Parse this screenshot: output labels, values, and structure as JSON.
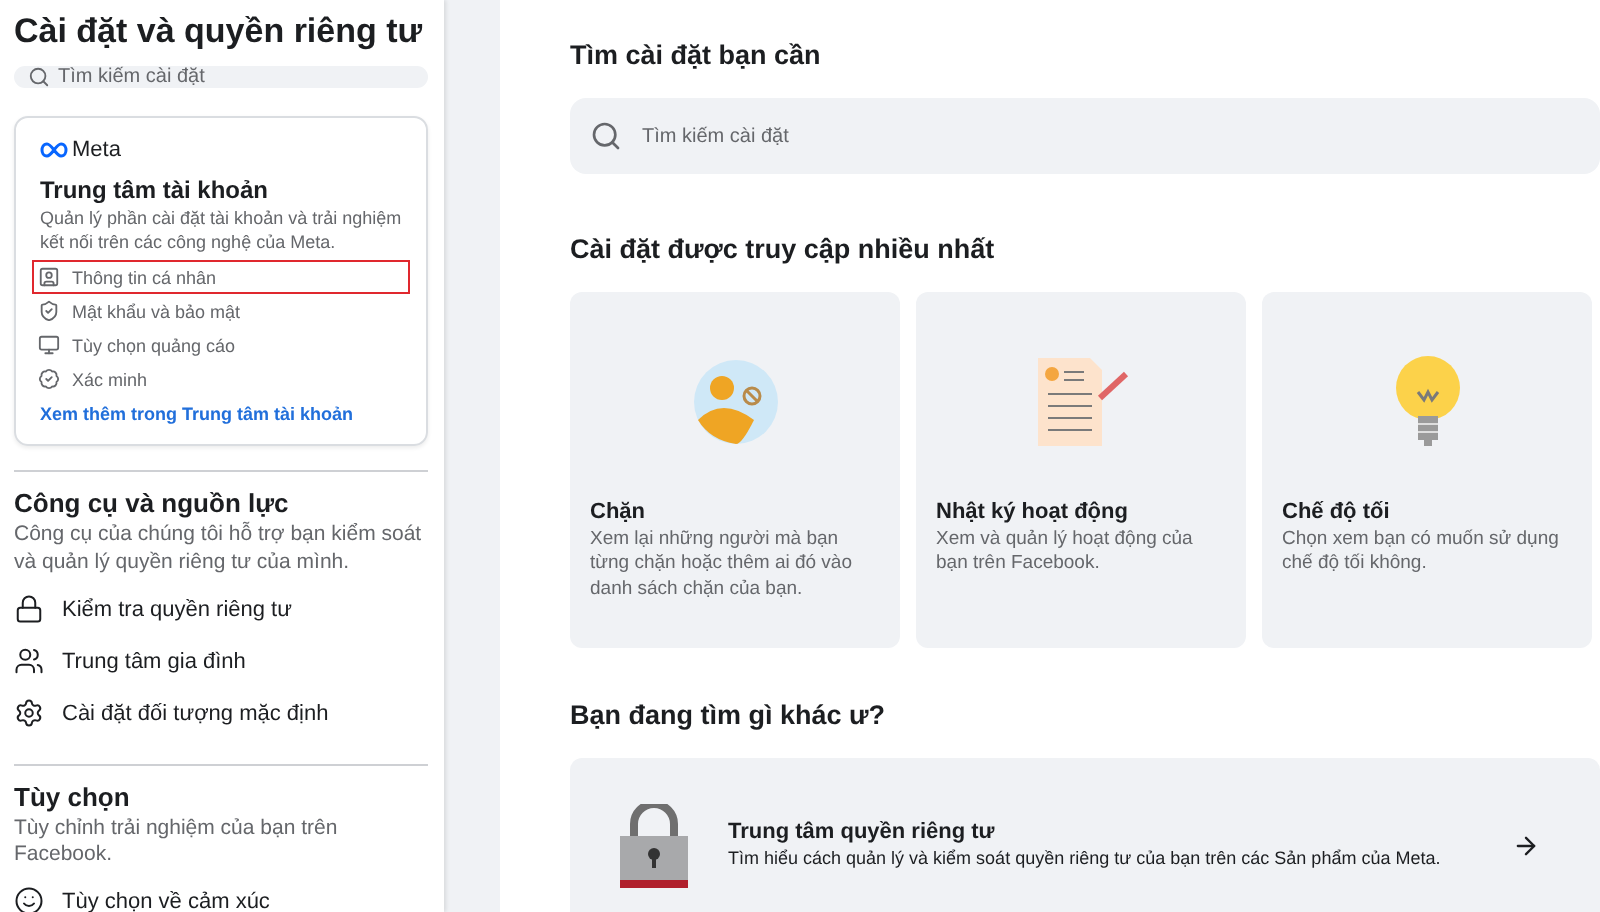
{
  "sidebar": {
    "title": "Cài đặt và quyền riêng tư",
    "search": {
      "placeholder": "Tìm kiếm cài đặt"
    },
    "accounts_center": {
      "brand": "Meta",
      "title": "Trung tâm tài khoản",
      "description": "Quản lý phần cài đặt tài khoản và trải nghiệm kết nối trên các công nghệ của Meta.",
      "items": [
        {
          "kind": "profile",
          "label": "Thông tin cá nhân",
          "highlighted": true
        },
        {
          "kind": "shield",
          "label": "Mật khẩu và bảo mật",
          "highlighted": false
        },
        {
          "kind": "ads",
          "label": "Tùy chọn quảng cáo",
          "highlighted": false
        },
        {
          "kind": "verify",
          "label": "Xác minh",
          "highlighted": false
        }
      ],
      "link": "Xem thêm trong Trung tâm tài khoản"
    },
    "sections": [
      {
        "title": "Công cụ và nguồn lực",
        "description": "Công cụ của chúng tôi hỗ trợ bạn kiểm soát và quản lý quyền riêng tư của mình.",
        "items": [
          {
            "kind": "lock",
            "label": "Kiểm tra quyền riêng tư"
          },
          {
            "kind": "family",
            "label": "Trung tâm gia đình"
          },
          {
            "kind": "gear",
            "label": "Cài đặt đối tượng mặc định"
          }
        ]
      },
      {
        "title": "Tùy chọn",
        "description": "Tùy chỉnh trải nghiệm của bạn trên Facebook.",
        "items": [
          {
            "kind": "emoji",
            "label": "Tùy chọn về cảm xúc"
          }
        ]
      }
    ]
  },
  "main": {
    "search_title": "Tìm cài đặt bạn cần",
    "search": {
      "placeholder": "Tìm kiếm cài đặt"
    },
    "frequent_title": "Cài đặt được truy cập nhiều nhất",
    "cards": [
      {
        "kind": "block",
        "title": "Chặn",
        "description": "Xem lại những người mà bạn từng chặn hoặc thêm ai đó vào danh sách chặn của bạn."
      },
      {
        "kind": "activity",
        "title": "Nhật ký hoạt động",
        "description": "Xem và quản lý hoạt động của bạn trên Facebook."
      },
      {
        "kind": "dark",
        "title": "Chế độ tối",
        "description": "Chọn xem bạn có muốn sử dụng chế độ tối không."
      }
    ],
    "other_title": "Bạn đang tìm gì khác ư?",
    "privacy_center": {
      "title": "Trung tâm quyền riêng tư",
      "description": "Tìm hiểu cách quản lý và kiểm soát quyền riêng tư của bạn trên các Sản phẩm của Meta."
    }
  }
}
